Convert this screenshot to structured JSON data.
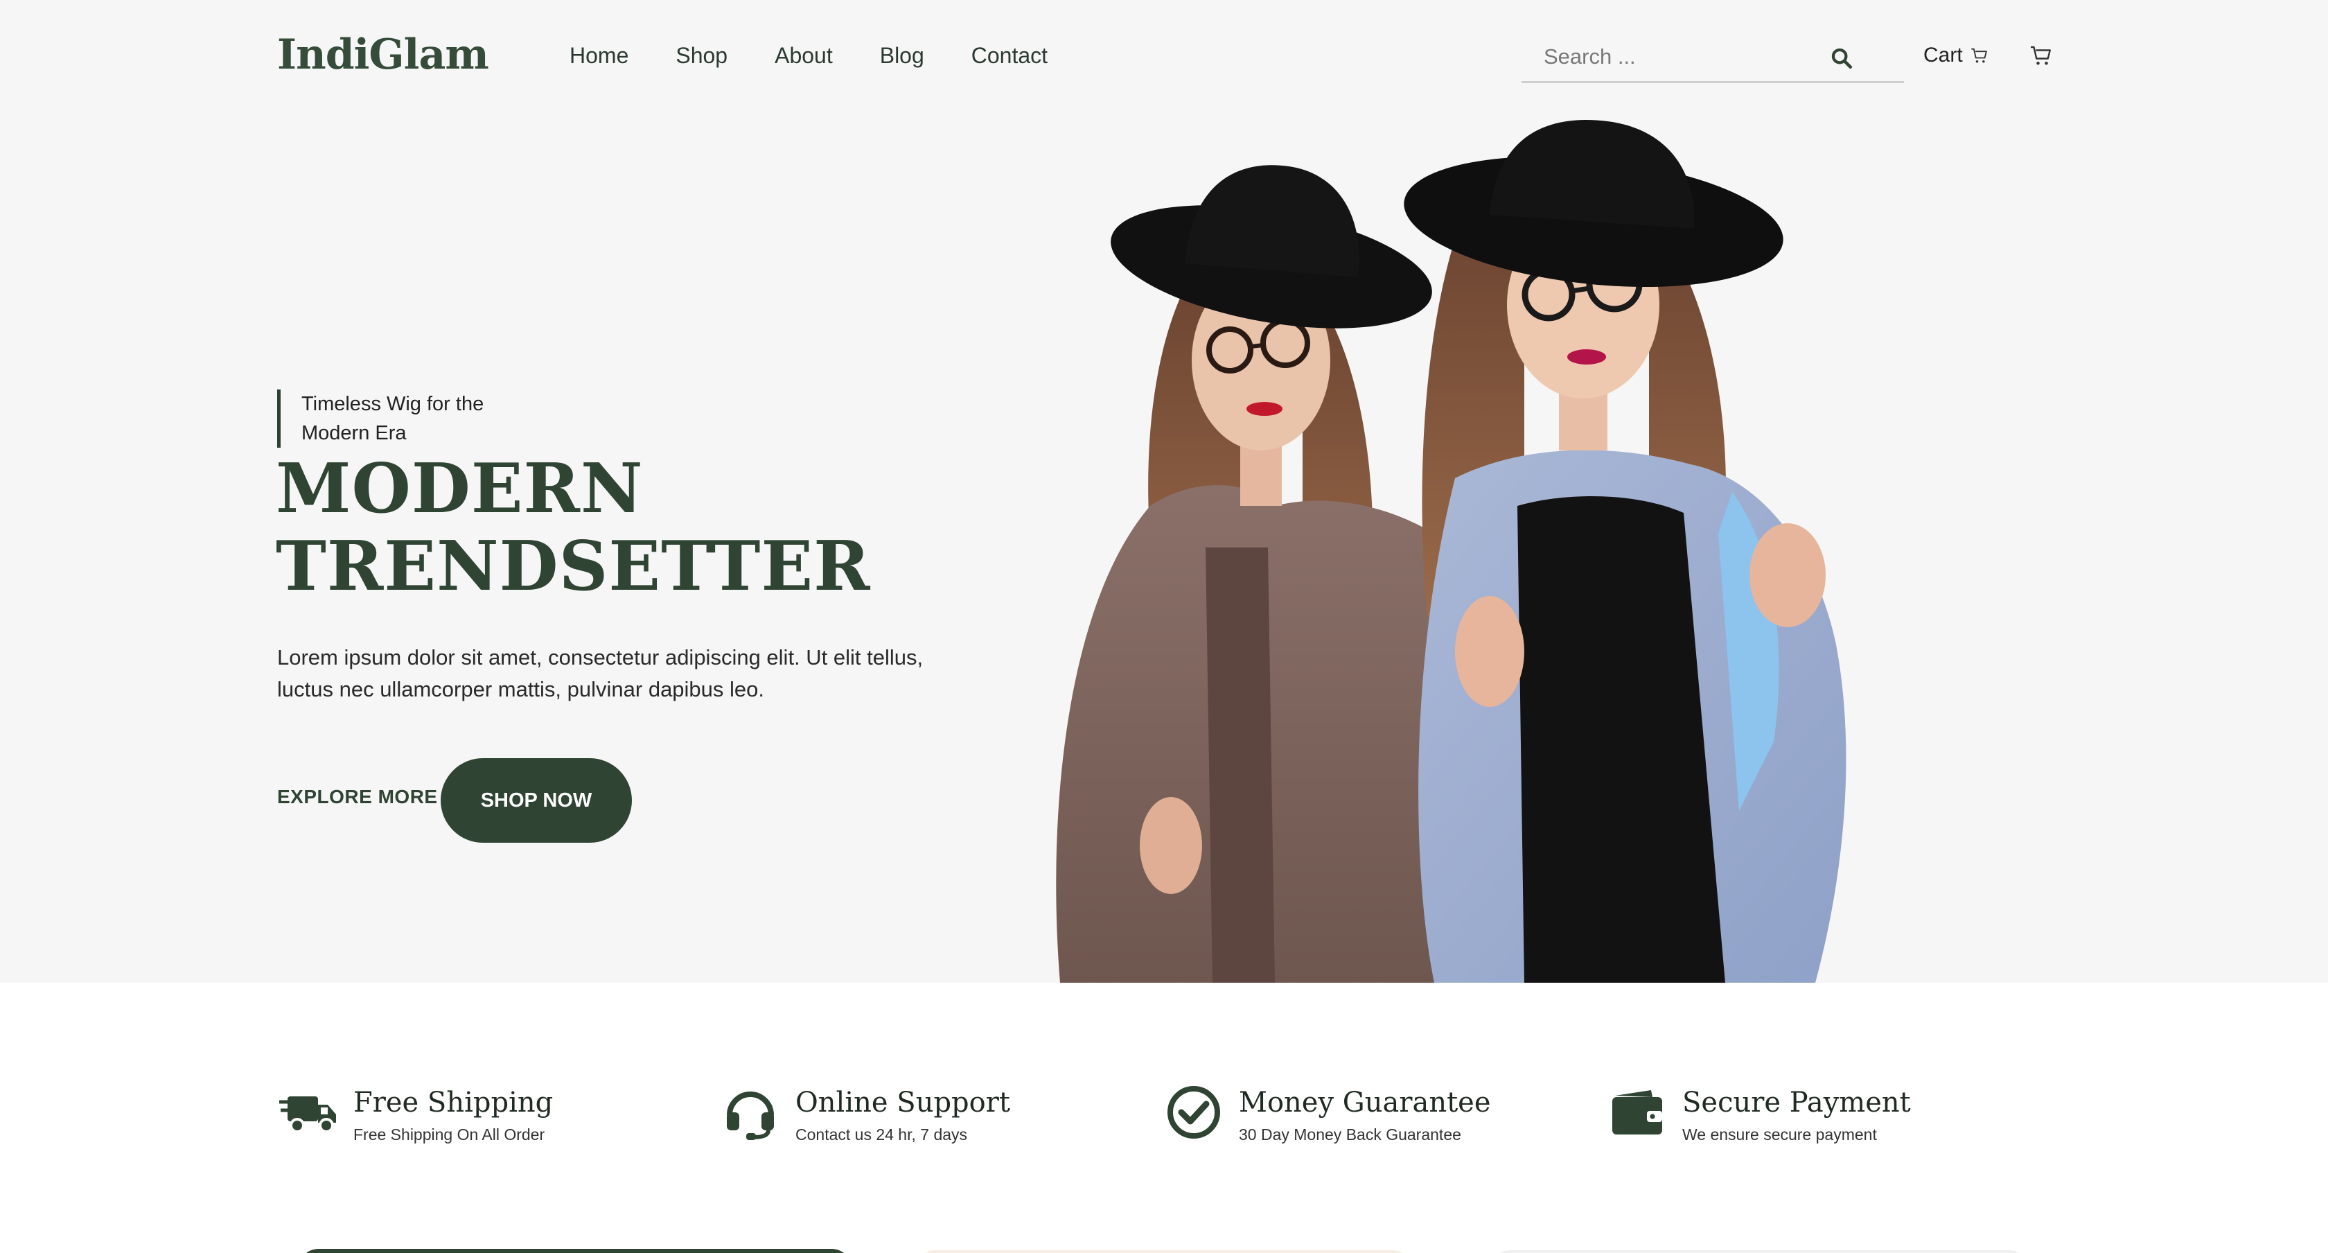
{
  "header": {
    "logo": "IndiGlam",
    "nav": [
      "Home",
      "Shop",
      "About",
      "Blog",
      "Contact"
    ],
    "search_placeholder": "Search ...",
    "cart_label": "Cart"
  },
  "hero": {
    "tagline": "Timeless Wig for the Modern Era",
    "title_line1": "MODERN",
    "title_line2": "TRENDSETTER",
    "description": "Lorem ipsum dolor sit amet, consectetur adipiscing elit. Ut elit tellus, luctus nec ullamcorper mattis, pulvinar dapibus leo.",
    "explore_label": "EXPLORE MORE",
    "shop_label": "SHOP NOW"
  },
  "features": [
    {
      "icon": "truck-icon",
      "title": "Free Shipping",
      "subtitle": "Free Shipping On All Order"
    },
    {
      "icon": "headset-icon",
      "title": "Online Support",
      "subtitle": "Contact us 24 hr, 7 days"
    },
    {
      "icon": "check-circle-icon",
      "title": "Money Guarantee",
      "subtitle": "30 Day Money Back Guarantee"
    },
    {
      "icon": "wallet-icon",
      "title": "Secure Payment",
      "subtitle": "We ensure secure payment"
    }
  ],
  "colors": {
    "brand": "#2f4433",
    "hero_bg": "#f6f6f6"
  }
}
